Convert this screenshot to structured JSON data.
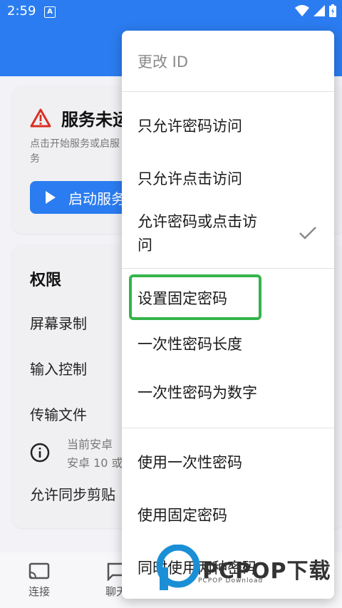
{
  "status_bar": {
    "time": "2:59",
    "notif_icon": "A"
  },
  "service_card": {
    "title": "服务未运",
    "description": "点击开始服务或启服务",
    "start_button": "启动服务"
  },
  "permissions_card": {
    "title": "权限",
    "items": [
      "屏幕录制",
      "输入控制",
      "传输文件"
    ],
    "info_line1": "当前安卓",
    "info_line2": "安卓 10 或",
    "clipboard": "允许同步剪贴"
  },
  "bottom_nav": {
    "connect": "连接",
    "chat": "聊天"
  },
  "menu": {
    "header": "更改 ID",
    "items": [
      "只允许密码访问",
      "只允许点击访问",
      "允许密码或点击访问",
      "设置固定密码",
      "一次性密码长度",
      "一次性密码为数字",
      "使用一次性密码",
      "使用固定密码",
      "同时使用两种密码"
    ],
    "allow_both_line1": "允许密码或点击访",
    "allow_both_line2": "问"
  },
  "watermark": {
    "text": "PCPOP下载",
    "sub": "PCPOP Download"
  },
  "colors": {
    "primary": "#2b7cf0",
    "highlight": "#35b44a",
    "warning": "#d93025"
  }
}
